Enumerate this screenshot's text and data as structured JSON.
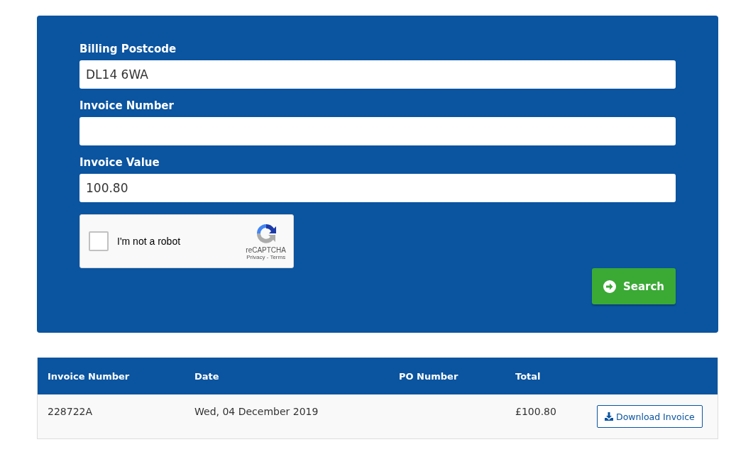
{
  "form": {
    "fields": [
      {
        "label": "Billing Postcode",
        "value": "DL14 6WA"
      },
      {
        "label": "Invoice Number"
      },
      {
        "label": "Invoice Value",
        "value": "100.80"
      }
    ],
    "captcha": {
      "label": "I'm not a robot",
      "checked": false,
      "brand": "reCAPTCHA",
      "privacy": "Privacy",
      "separator": "-",
      "terms": "Terms"
    },
    "search_button": "Search"
  },
  "table": {
    "columns": [
      "Invoice Number",
      "Date",
      "PO Number",
      "Total"
    ],
    "rows": [
      {
        "cells": [
          "228722A",
          "Wed, 04 December 2019",
          null,
          "£100.80"
        ],
        "action": "Download Invoice"
      }
    ]
  }
}
